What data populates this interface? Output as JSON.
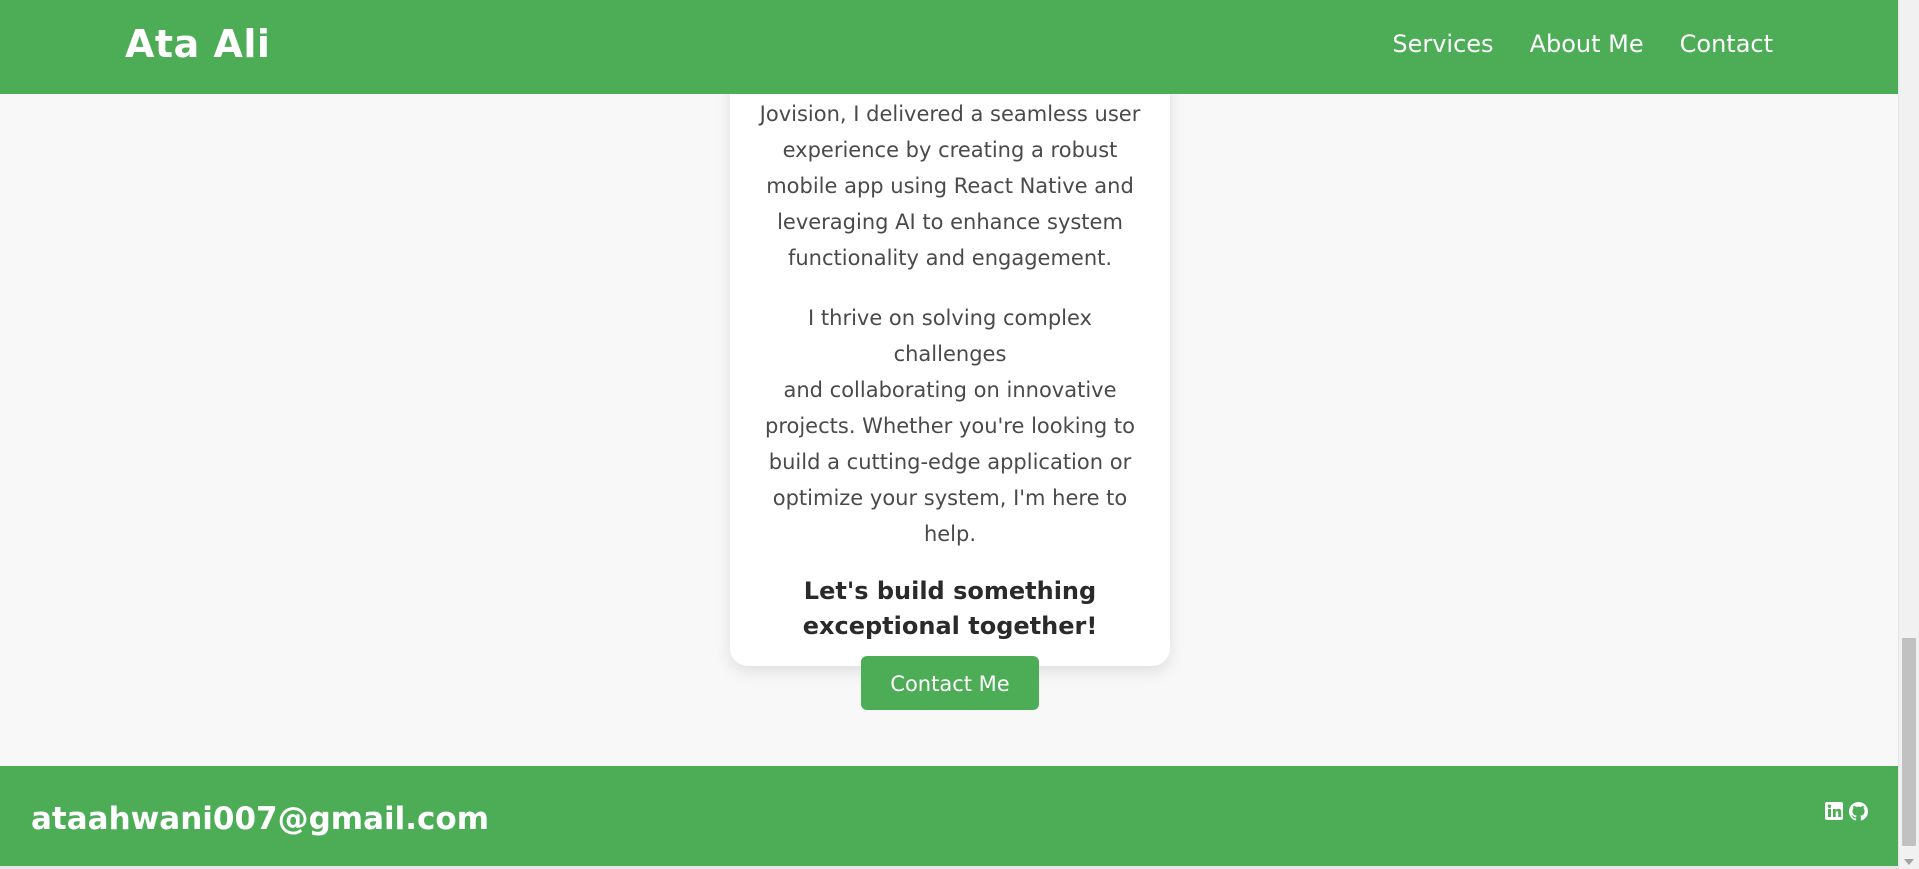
{
  "header": {
    "brand": "Ata Ali",
    "nav": [
      {
        "label": "Services"
      },
      {
        "label": "About Me"
      },
      {
        "label": "Contact"
      }
    ]
  },
  "card": {
    "para1_lines": [
      "Jovision, I delivered a seamless user",
      "experience by creating a robust",
      "mobile app using React Native and",
      "leveraging AI to enhance system",
      "functionality and engagement."
    ],
    "para2_lines": [
      "I thrive on solving complex challenges",
      "and collaborating on innovative",
      "projects. Whether you're looking to",
      "build a cutting-edge application or",
      "optimize your system, I'm here to help."
    ],
    "cta_heading": "Let's build something exceptional together!",
    "contact_button": "Contact Me"
  },
  "footer": {
    "email": "ataahwani007@gmail.com",
    "socials": [
      {
        "icon": "linkedin-icon"
      },
      {
        "icon": "github-icon"
      }
    ]
  },
  "colors": {
    "accent": "#4cad56",
    "background": "#f8f8f8",
    "card": "#ffffff",
    "text": "#4a4a4a"
  }
}
